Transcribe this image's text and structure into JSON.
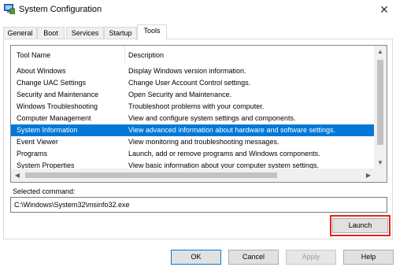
{
  "window": {
    "title": "System Configuration"
  },
  "tabs": [
    "General",
    "Boot",
    "Services",
    "Startup",
    "Tools"
  ],
  "list": {
    "columns": [
      "Tool Name",
      "Description"
    ],
    "rows": [
      {
        "name": "About Windows",
        "desc": "Display Windows version information."
      },
      {
        "name": "Change UAC Settings",
        "desc": "Change User Account Control settings."
      },
      {
        "name": "Security and Maintenance",
        "desc": "Open Security and Maintenance."
      },
      {
        "name": "Windows Troubleshooting",
        "desc": "Troubleshoot problems with your computer."
      },
      {
        "name": "Computer Management",
        "desc": "View and configure system settings and components."
      },
      {
        "name": "System Information",
        "desc": "View advanced information about hardware and software settings."
      },
      {
        "name": "Event Viewer",
        "desc": "View monitoring and troubleshooting messages."
      },
      {
        "name": "Programs",
        "desc": "Launch, add or remove programs and Windows components."
      },
      {
        "name": "System Properties",
        "desc": "View basic information about your computer system settings."
      }
    ],
    "selected": "System Information"
  },
  "selected_command": {
    "label": "Selected command:",
    "value": "C:\\Windows\\System32\\msinfo32.exe"
  },
  "buttons": {
    "launch": "Launch",
    "ok": "OK",
    "cancel": "Cancel",
    "apply": "Apply",
    "help": "Help"
  },
  "colors": {
    "selection": "#0078d7",
    "highlight_box": "#e2231a"
  }
}
